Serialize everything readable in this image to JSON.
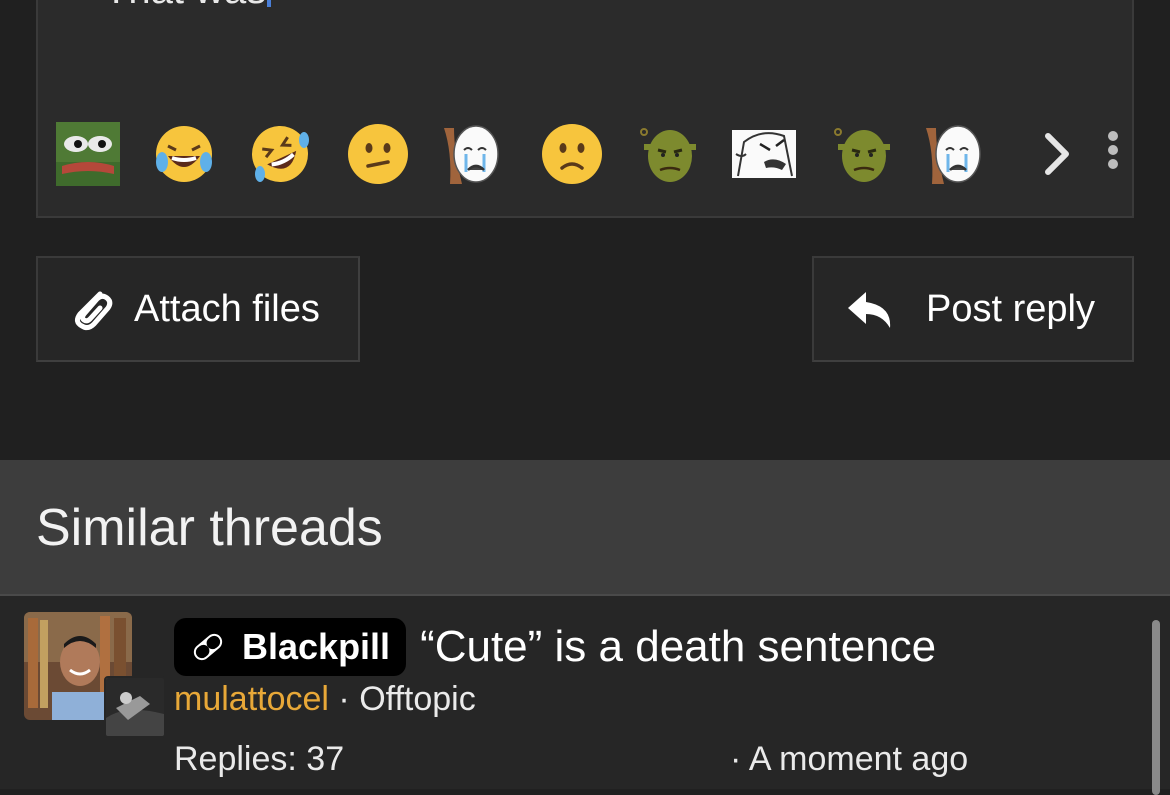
{
  "editor": {
    "text": "That was",
    "smilies": [
      "pepe",
      "joy",
      "rofl",
      "confused",
      "cry-meme",
      "frown",
      "shrek",
      "rage-meme",
      "shrek",
      "cry-meme"
    ],
    "more_icon": "chevron-right-icon",
    "menu_icon": "vertical-dots-icon"
  },
  "buttons": {
    "attach_label": "Attach files",
    "reply_label": "Post reply"
  },
  "similar": {
    "title": "Similar threads",
    "threads": [
      {
        "prefix": "Blackpill",
        "title": "“Cute” is a death sentence",
        "username": "mulattocel",
        "forum": "· Offtopic",
        "replies": "Replies: 37",
        "time": "· A moment ago"
      }
    ]
  },
  "colors": {
    "background": "#202020",
    "editor_bg": "#2b2b2b",
    "header_bg": "#3d3d3d",
    "username": "#e8a838",
    "caret": "#4a7fd8"
  }
}
